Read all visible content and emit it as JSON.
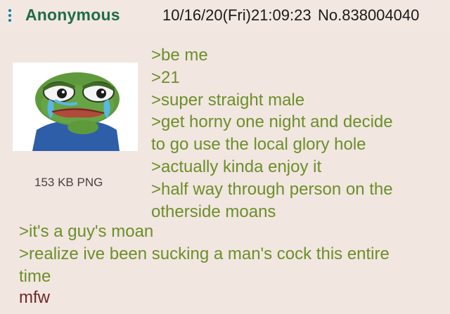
{
  "post": {
    "name": "Anonymous",
    "date": "10/16/20(Fri)21:09:23",
    "number": "No.838004040"
  },
  "file": {
    "info": "153 KB PNG",
    "icon": "crying-frog-image"
  },
  "lines_beside_image": [
    ">be me",
    ">21",
    ">super straight male",
    ">get horny one night and decide",
    "to go use the local glory hole",
    ">actually kinda enjoy it",
    ">half way through person on the",
    "otherside moans"
  ],
  "lines_below_image": [
    ">it's a guy's moan",
    ">realize ive been sucking a man's cock this entire",
    "time"
  ],
  "closing_line": "mfw",
  "colors": {
    "background": "#f2e6e0",
    "name": "#1f6d47",
    "greentext": "#6b8f2a",
    "plain_text": "#6a2a2a"
  }
}
